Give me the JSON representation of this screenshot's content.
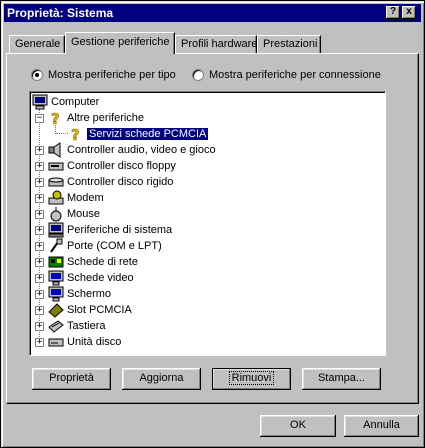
{
  "window": {
    "title": "Proprietà: Sistema",
    "help_btn": "?",
    "close_btn": "x"
  },
  "tabs": [
    "Generale",
    "Gestione periferiche",
    "Profili hardware",
    "Prestazioni"
  ],
  "radio": {
    "by_type": {
      "label": "Mostra periferiche per tipo",
      "checked": true
    },
    "by_connection": {
      "label": "Mostra periferiche per connessione",
      "checked": false
    }
  },
  "tree": {
    "root": {
      "label": "Computer",
      "icon": "computer-icon"
    },
    "items": [
      {
        "label": "Altre periferiche",
        "icon": "question-icon",
        "expanded": true
      },
      {
        "label": "Servizi schede PCMCIA",
        "icon": "question-icon",
        "child": true,
        "selected": true
      },
      {
        "label": "Controller audio, video e gioco",
        "icon": "speaker-icon"
      },
      {
        "label": "Controller disco floppy",
        "icon": "floppy-controller-icon"
      },
      {
        "label": "Controller disco rigido",
        "icon": "hard-disk-controller-icon"
      },
      {
        "label": "Modem",
        "icon": "modem-icon"
      },
      {
        "label": "Mouse",
        "icon": "mouse-icon"
      },
      {
        "label": "Periferiche di sistema",
        "icon": "system-device-icon"
      },
      {
        "label": "Porte (COM e LPT)",
        "icon": "port-icon"
      },
      {
        "label": "Schede di rete",
        "icon": "network-card-icon"
      },
      {
        "label": "Schede video",
        "icon": "monitor-icon"
      },
      {
        "label": "Schermo",
        "icon": "monitor-icon"
      },
      {
        "label": "Slot PCMCIA",
        "icon": "pcmcia-icon"
      },
      {
        "label": "Tastiera",
        "icon": "keyboard-icon"
      },
      {
        "label": "Unità disco",
        "icon": "disk-drive-icon"
      }
    ]
  },
  "buttons": {
    "properties": "Proprietà",
    "refresh": "Aggiorna",
    "remove": "Rimuovi",
    "print": "Stampa...",
    "ok": "OK",
    "cancel": "Annulla"
  }
}
